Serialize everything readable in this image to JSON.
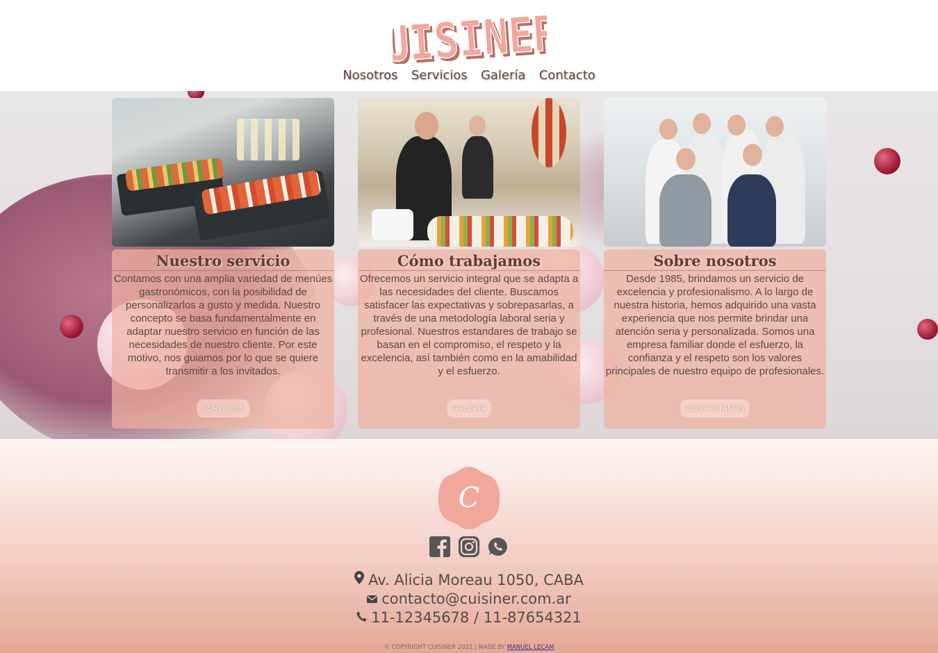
{
  "brand": {
    "logo_text": "CUISINER",
    "logo_color": "#f0a49a"
  },
  "nav": {
    "items": [
      "Nosotros",
      "Servicios",
      "Galería",
      "Contacto"
    ]
  },
  "cards": [
    {
      "title": "Nuestro servicio",
      "text": "Contamos con una amplia variedad de menúes gastronómicos, con la posibilidad de personalizarlos a gusto y medida. Nuestro concepto se basa fundamentalmente en adaptar nuestro servicio en función de las necesidades de nuestro cliente. Por este motivo, nos guiamos por lo que se quiere transmitir a los invitados.",
      "button": "SERVICIOS"
    },
    {
      "title": "Cómo trabajamos",
      "text": "Ofrecemos un servicio integral que se adapta a las necesidades del cliente. Buscamos satisfacer las expectativas y sobrepasarlas, a través de una metodología laboral seria y profesional. Nuestros estandares de trabajo se basan en el compromiso, el respeto y la excelencia, así también como en la amabilidad y el esfuerzo.",
      "button": "GALERÍA"
    },
    {
      "title": "Sobre nosotros",
      "text": "Desde 1985, brindamos un servicio de excelencia y profesionalismo. A lo largo de nuestra historia, hemos adquirido una vasta experiencia que nos permite brindar una atención seria y personalizada. Somos una empresa familiar donde el esfuerzo, la confianza y el respeto son los valores principales de nuestro equipo de profesionales.",
      "button": "CONTACTANOS"
    }
  ],
  "footer": {
    "badge_letter": "C",
    "badge_color": "#f2a79b",
    "social": [
      "facebook-icon",
      "instagram-icon",
      "whatsapp-icon"
    ],
    "address": "Av. Alicia Moreau 1050, CABA",
    "email": "contacto@cuisiner.com.ar",
    "phone": "11-12345678 / 11-87654321",
    "copyright": "© COPYRIGHT CUISINER 2022 | MADE BY ",
    "author": "MANUEL LECAM"
  }
}
